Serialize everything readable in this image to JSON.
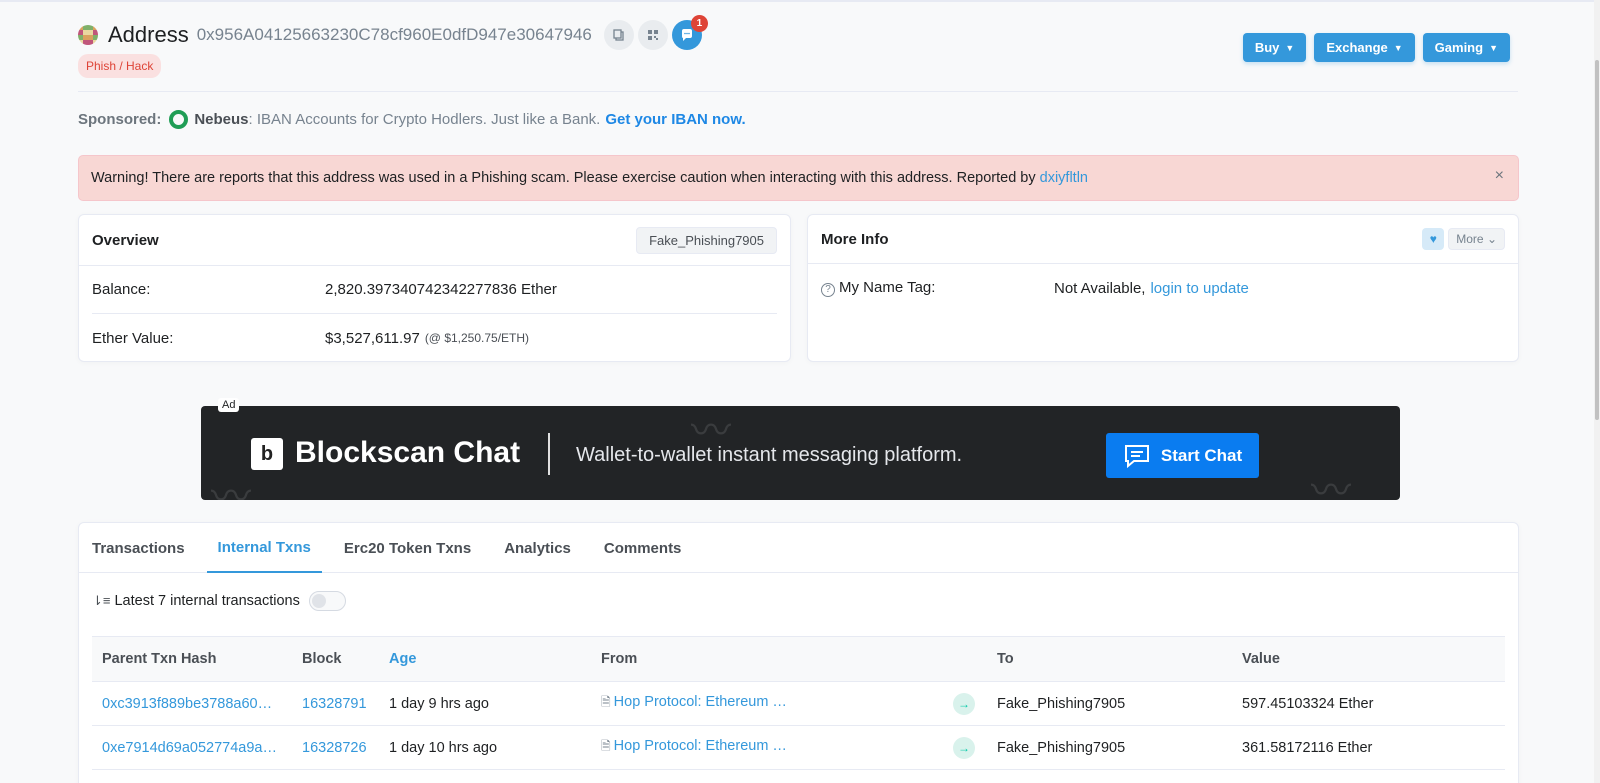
{
  "header": {
    "title": "Address",
    "address": "0x956A04125663230C78cf960E0dfD947e30647946",
    "badge": "Phish / Hack",
    "notification_count": "1",
    "buttons": [
      {
        "label": "Buy"
      },
      {
        "label": "Exchange"
      },
      {
        "label": "Gaming"
      }
    ]
  },
  "sponsored": {
    "label": "Sponsored:",
    "brand": "Nebeus",
    "text": ": IBAN Accounts for Crypto Hodlers. Just like a Bank.",
    "link": "Get your IBAN now."
  },
  "warning": {
    "text": "Warning! There are reports that this address was used in a Phishing scam. Please exercise caution when interacting with this address. Reported by",
    "reporter": "dxiyfltln",
    "close": "×"
  },
  "overview": {
    "title": "Overview",
    "tag": "Fake_Phishing7905",
    "balance_label": "Balance:",
    "balance_value": "2,820.397340742342277836 Ether",
    "ether_value_label": "Ether Value:",
    "ether_value": "$3,527,611.97",
    "ether_rate": "(@ $1,250.75/ETH)"
  },
  "more_info": {
    "title": "More Info",
    "more_label": "More",
    "name_tag_label": "My Name Tag:",
    "name_tag_value": "Not Available,",
    "name_tag_link": "login to update"
  },
  "ad": {
    "label": "Ad",
    "logo_letter": "b",
    "brand": "Blockscan Chat",
    "tagline": "Wallet-to-wallet instant messaging platform.",
    "cta": "Start Chat"
  },
  "tabs": [
    {
      "label": "Transactions",
      "active": false
    },
    {
      "label": "Internal Txns",
      "active": true
    },
    {
      "label": "Erc20 Token Txns",
      "active": false
    },
    {
      "label": "Analytics",
      "active": false
    },
    {
      "label": "Comments",
      "active": false
    }
  ],
  "internal": {
    "summary": "Latest 7 internal transactions",
    "columns": [
      "Parent Txn Hash",
      "Block",
      "Age",
      "From",
      "",
      "To",
      "Value"
    ],
    "rows": [
      {
        "hash": "0xc3913f889be3788a60…",
        "block": "16328791",
        "age": "1 day 9 hrs ago",
        "from": "Hop Protocol: Ethereum …",
        "to": "Fake_Phishing7905",
        "value": "597.45103324 Ether"
      },
      {
        "hash": "0xe7914d69a052774a9a…",
        "block": "16328726",
        "age": "1 day 10 hrs ago",
        "from": "Hop Protocol: Ethereum …",
        "to": "Fake_Phishing7905",
        "value": "361.58172116 Ether"
      }
    ]
  },
  "colors": {
    "accent": "#3498db",
    "danger": "#de4437",
    "warning_bg": "#f8d7d4",
    "ad_bg": "#222426",
    "ad_cta": "#0a7cf0"
  }
}
